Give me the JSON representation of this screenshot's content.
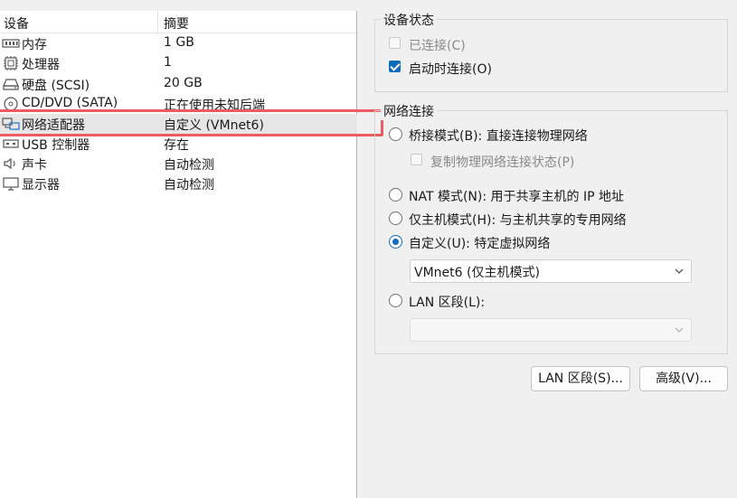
{
  "device_list": {
    "col_device": "设备",
    "col_summary": "摘要",
    "rows": [
      {
        "name": "内存",
        "summary": "1 GB",
        "icon": "memory-icon"
      },
      {
        "name": "处理器",
        "summary": "1",
        "icon": "cpu-icon"
      },
      {
        "name": "硬盘 (SCSI)",
        "summary": "20 GB",
        "icon": "hard-disk-icon"
      },
      {
        "name": "CD/DVD (SATA)",
        "summary": "正在使用未知后端",
        "icon": "cd-dvd-icon"
      },
      {
        "name": "网络适配器",
        "summary": "自定义 (VMnet6)",
        "icon": "network-adapter-icon",
        "selected": true
      },
      {
        "name": "USB 控制器",
        "summary": "存在",
        "icon": "usb-icon"
      },
      {
        "name": "声卡",
        "summary": "自动检测",
        "icon": "speaker-icon"
      },
      {
        "name": "显示器",
        "summary": "自动检测",
        "icon": "monitor-icon"
      }
    ]
  },
  "device_status": {
    "title": "设备状态",
    "connected_label": "已连接(C)",
    "connected_checked": false,
    "connected_enabled": false,
    "connect_on_start_label": "启动时连接(O)",
    "connect_on_start_checked": true
  },
  "network_connection": {
    "title": "网络连接",
    "bridged_label": "桥接模式(B): 直接连接物理网络",
    "replicate_label": "复制物理网络连接状态(P)",
    "nat_label": "NAT 模式(N): 用于共享主机的 IP 地址",
    "hostonly_label": "仅主机模式(H): 与主机共享的专用网络",
    "custom_label": "自定义(U): 特定虚拟网络",
    "custom_selected_value": "VMnet6 (仅主机模式)",
    "lan_label": "LAN 区段(L):",
    "lan_selected_value": "",
    "selected_mode": "custom"
  },
  "buttons": {
    "lan_segments": "LAN 区段(S)...",
    "advanced": "高级(V)..."
  },
  "colors": {
    "accent": "#0f6cbd",
    "highlight": "#ec5a62"
  }
}
